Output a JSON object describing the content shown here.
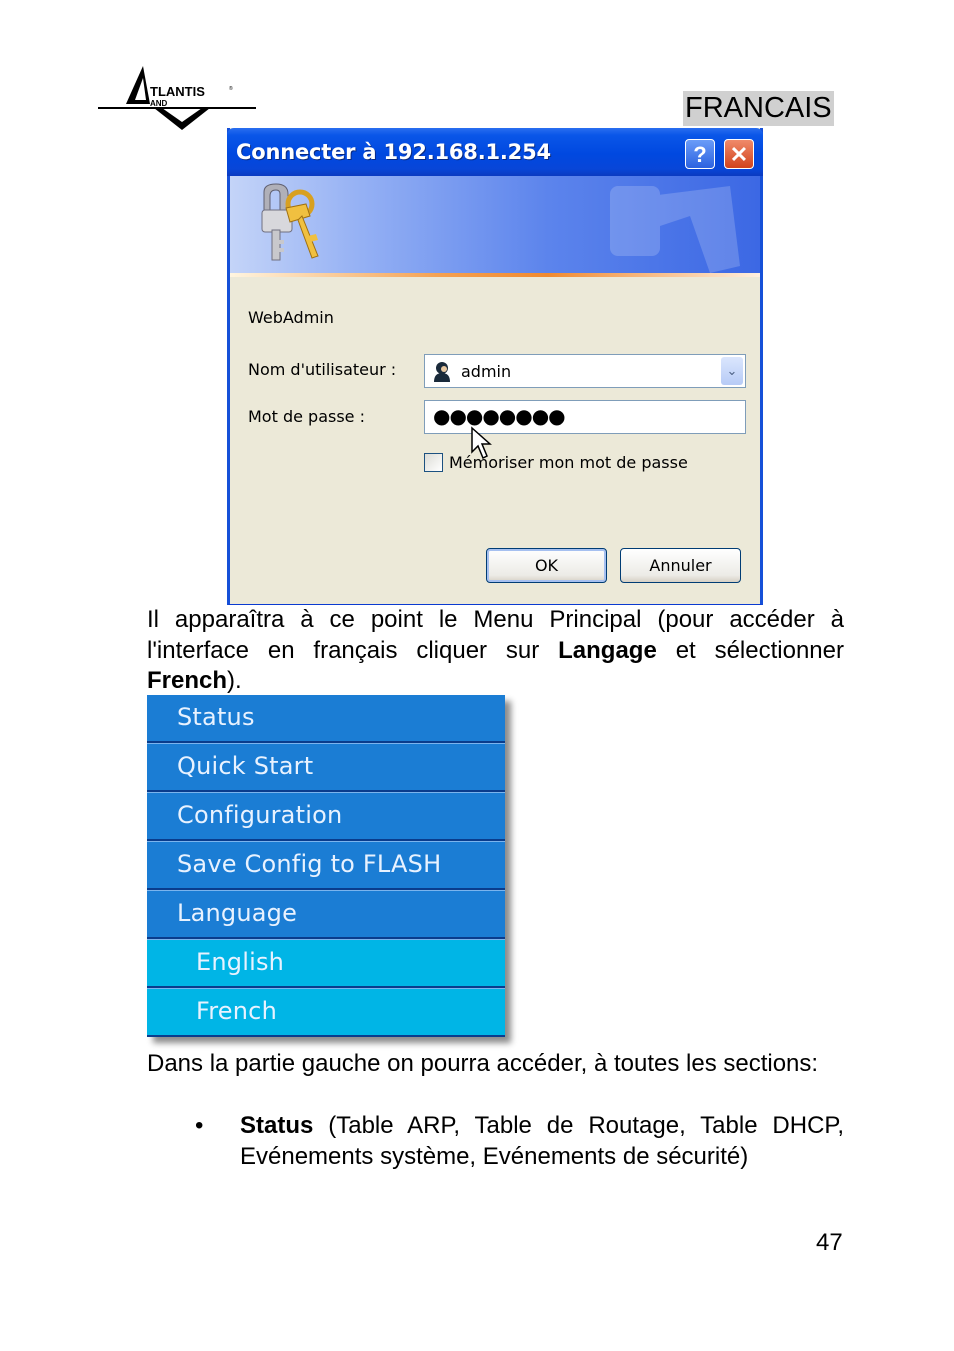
{
  "header": {
    "logo_alt": "Atlantis Land",
    "logo_text_main": "TLANTIS",
    "logo_text_sub": "AND",
    "section_label": "FRANCAIS"
  },
  "dialog": {
    "title": "Connecter à 192.168.1.254",
    "help_button": "?",
    "close_button": "✕",
    "realm": "WebAdmin",
    "username_label": "Nom d'utilisateur :",
    "username_value": "admin",
    "password_label": "Mot de passe :",
    "password_value": "●●●●●●●●",
    "remember_label": "Mémoriser mon mot de passe",
    "remember_checked": false,
    "ok_label": "OK",
    "cancel_label": "Annuler",
    "accent_color": "#0a56e8"
  },
  "body": {
    "para1_pre": "Il apparaîtra à ce point le Menu Principal (pour accéder à l'interface en français cliquer sur ",
    "para1_bold1": "Langage",
    "para1_mid": " et sélectionner ",
    "para1_bold2": "French",
    "para1_post": ").",
    "para2": "Dans la partie gauche on pourra accéder, à toutes les sections:",
    "bullets": [
      {
        "dot": "•",
        "bold": "Status",
        "text": " (Table ARP, Table de Routage, Table DHCP, Evénements système, Evénements de sécurité)"
      }
    ]
  },
  "menu": {
    "items": [
      {
        "label": "Status"
      },
      {
        "label": "Quick Start"
      },
      {
        "label": "Configuration"
      },
      {
        "label": "Save Config to FLASH"
      },
      {
        "label": "Language"
      },
      {
        "label": "English"
      },
      {
        "label": "French"
      }
    ],
    "primary_color": "#1b7dd4",
    "sub_color": "#00b5e6"
  },
  "footer": {
    "page_number": "47"
  }
}
